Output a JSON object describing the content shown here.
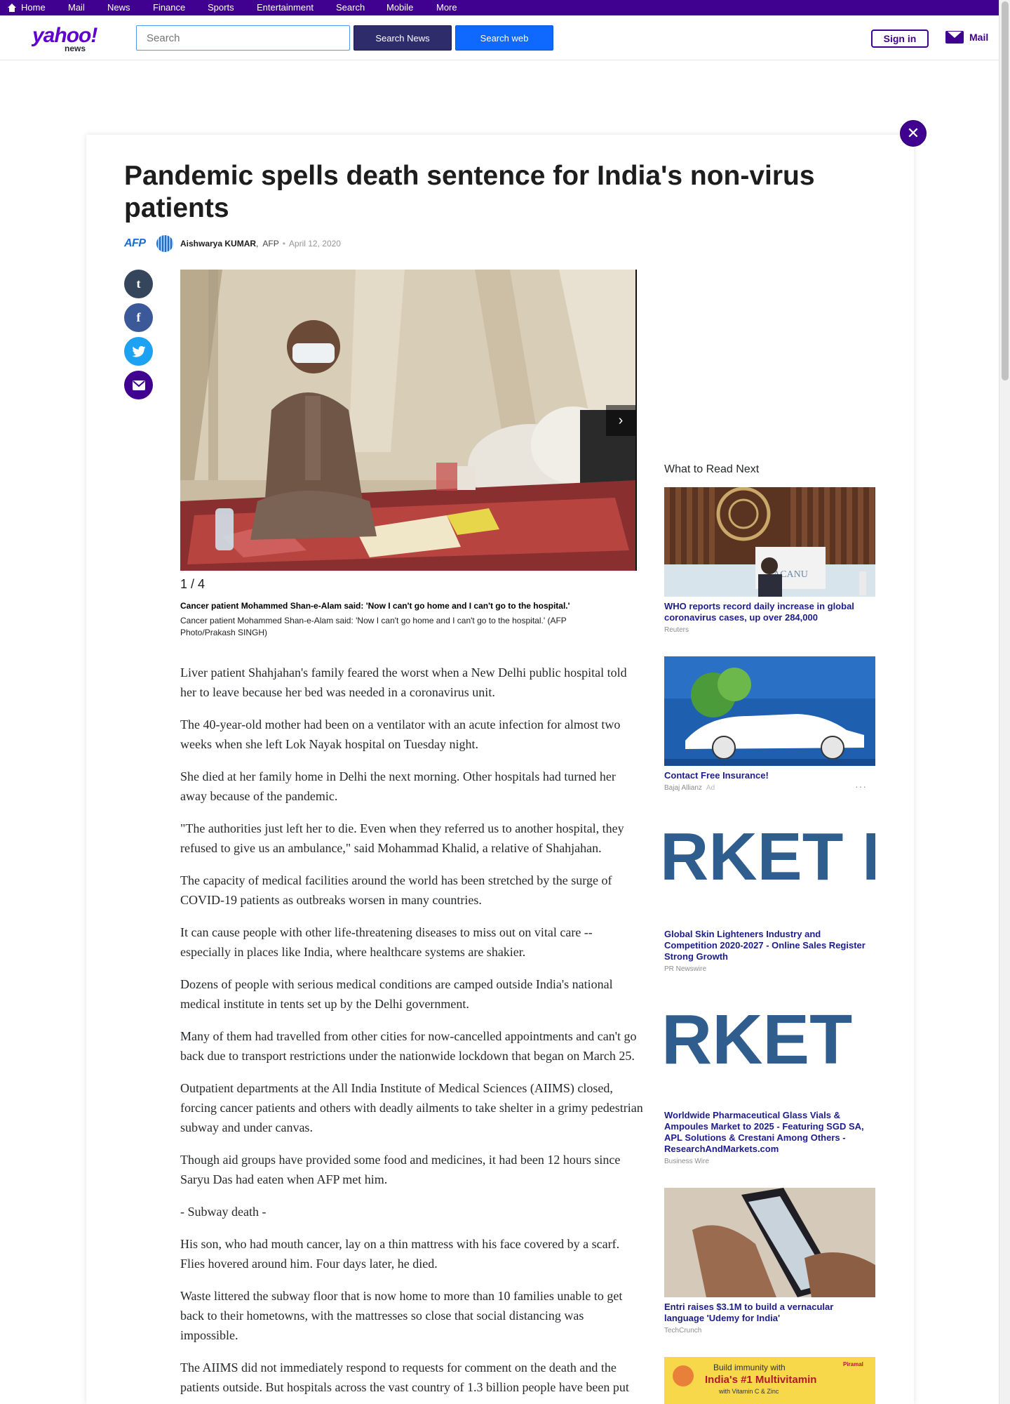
{
  "topnav": {
    "items": [
      "Home",
      "Mail",
      "News",
      "Finance",
      "Sports",
      "Entertainment",
      "Search",
      "Mobile",
      "More"
    ]
  },
  "header": {
    "logo_text": "yahoo!",
    "logo_sub": "news",
    "search_placeholder": "Search",
    "search_news_label": "Search News",
    "search_web_label": "Search web",
    "signin_label": "Sign in",
    "mail_label": "Mail"
  },
  "article": {
    "title": "Pandemic spells death sentence for India's non-virus patients",
    "logo_text": "AFP",
    "author": "Aishwarya KUMAR",
    "source": "AFP",
    "date": "April 12, 2020",
    "slide_counter": "1 / 4",
    "caption_title": "Cancer patient Mohammed Shan-e-Alam said: 'Now I can't go home and I can't go to the hospital.'",
    "caption_body": "Cancer patient Mohammed Shan-e-Alam said: 'Now I can't go home and I can't go to the hospital.' (AFP Photo/Prakash SINGH)",
    "paragraphs": [
      "Liver patient Shahjahan's family feared the worst when a New Delhi public hospital told her to leave because her bed was needed in a coronavirus unit.",
      "The 40-year-old mother had been on a ventilator with an acute infection for almost two weeks when she left Lok Nayak hospital on Tuesday night.",
      "She died at her family home in Delhi the next morning. Other hospitals had turned her away because of the pandemic.",
      "\"The authorities just left her to die. Even when they referred us to another hospital, they refused to give us an ambulance,\" said Mohammad Khalid, a relative of Shahjahan.",
      "The capacity of medical facilities around the world has been stretched by the surge of COVID-19 patients as outbreaks worsen in many countries.",
      "It can cause people with other life-threatening diseases to miss out on vital care -- especially in places like India, where healthcare systems are shakier.",
      "Dozens of people with serious medical conditions are camped outside India's national medical institute in tents set up by the Delhi government.",
      "Many of them had travelled from other cities for now-cancelled appointments and can't go back due to transport restrictions under the nationwide lockdown that began on March 25.",
      "Outpatient departments at the All India Institute of Medical Sciences (AIIMS) closed, forcing cancer patients and others with deadly ailments to take shelter in a grimy pedestrian subway and under canvas.",
      "Though aid groups have provided some food and medicines, it had been 12 hours since Saryu Das had eaten when AFP met him.",
      "- Subway death -",
      "His son, who had mouth cancer, lay on a thin mattress with his face covered by a scarf. Flies hovered around him. Four days later, he died.",
      "Waste littered the subway floor that is now home to more than 10 families unable to get back to their hometowns, with the mattresses so close that social distancing was impossible.",
      "The AIIMS did not immediately respond to requests for comment on the death and the patients outside. But hospitals across the vast country of 1.3 billion people have been put"
    ]
  },
  "sidebar": {
    "heading": "What to Read Next",
    "items": [
      {
        "title": "WHO reports record daily increase in global coronavirus cases, up over 284,000",
        "source": "Reuters",
        "ad": "",
        "image_text": "ACANU"
      },
      {
        "title": "Contact Free Insurance!",
        "source": "Bajaj Allianz",
        "ad": "Ad",
        "image_text": ""
      },
      {
        "title": "Global Skin Lighteners Industry and Competition 2020-2027 - Online Sales Register Strong Growth",
        "source": "PR Newswire",
        "ad": "",
        "image_text": "RKET EARCH STO"
      },
      {
        "title": "Worldwide Pharmaceutical Glass Vials & Ampoules Market to 2025 - Featuring SGD SA, APL Solutions & Crestani Among Others - ResearchAndMarkets.com",
        "source": "Business Wire",
        "ad": "",
        "image_text": "RKET EARCH ST"
      },
      {
        "title": "Entri raises $3.1M to build a vernacular language 'Udemy for India'",
        "source": "TechCrunch",
        "ad": "",
        "image_text": ""
      }
    ],
    "promo": {
      "line1": "Build immunity with",
      "line2": "India's #1 Multivitamin",
      "line3": "with Vitamin C & Zinc",
      "brand": "Piramal"
    }
  },
  "colors": {
    "brand": "#400090",
    "search_blue": "#0f69ff",
    "link": "#1d1d8a"
  }
}
